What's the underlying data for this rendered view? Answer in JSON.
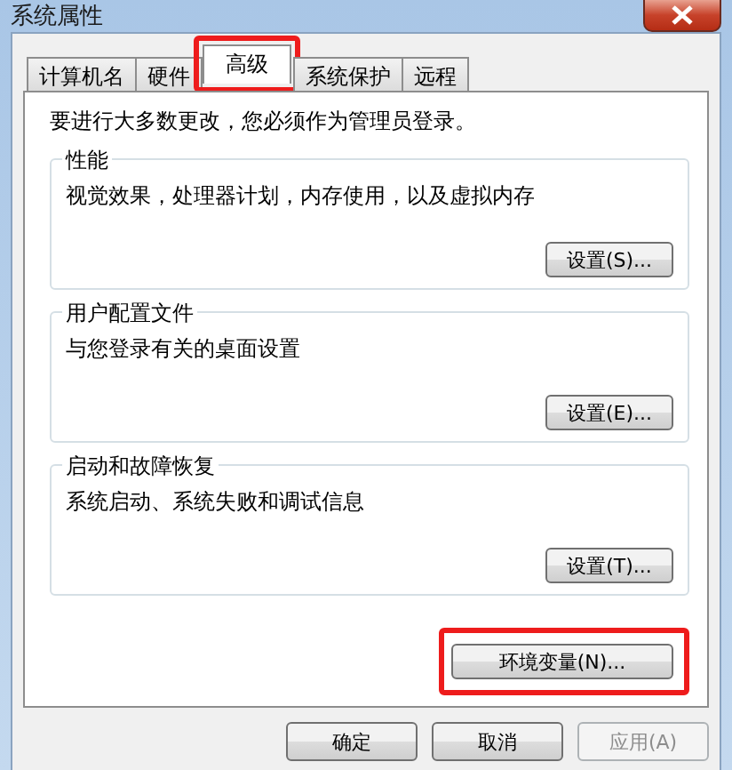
{
  "window": {
    "title": "系统属性"
  },
  "tabs": [
    {
      "label": "计算机名",
      "selected": false,
      "highlighted": false
    },
    {
      "label": "硬件",
      "selected": false,
      "highlighted": false
    },
    {
      "label": "高级",
      "selected": true,
      "highlighted": true
    },
    {
      "label": "系统保护",
      "selected": false,
      "highlighted": false
    },
    {
      "label": "远程",
      "selected": false,
      "highlighted": false
    }
  ],
  "notice": "要进行大多数更改，您必须作为管理员登录。",
  "groups": [
    {
      "title": "性能",
      "description": "视觉效果，处理器计划，内存使用，以及虚拟内存",
      "button": "设置(S)..."
    },
    {
      "title": "用户配置文件",
      "description": "与您登录有关的桌面设置",
      "button": "设置(E)..."
    },
    {
      "title": "启动和故障恢复",
      "description": "系统启动、系统失败和调试信息",
      "button": "设置(T)..."
    }
  ],
  "env_button": {
    "label": "环境变量(N)...",
    "highlighted": true
  },
  "buttons": [
    {
      "label": "确定",
      "disabled": false
    },
    {
      "label": "取消",
      "disabled": false
    },
    {
      "label": "应用(A)",
      "disabled": true
    }
  ]
}
